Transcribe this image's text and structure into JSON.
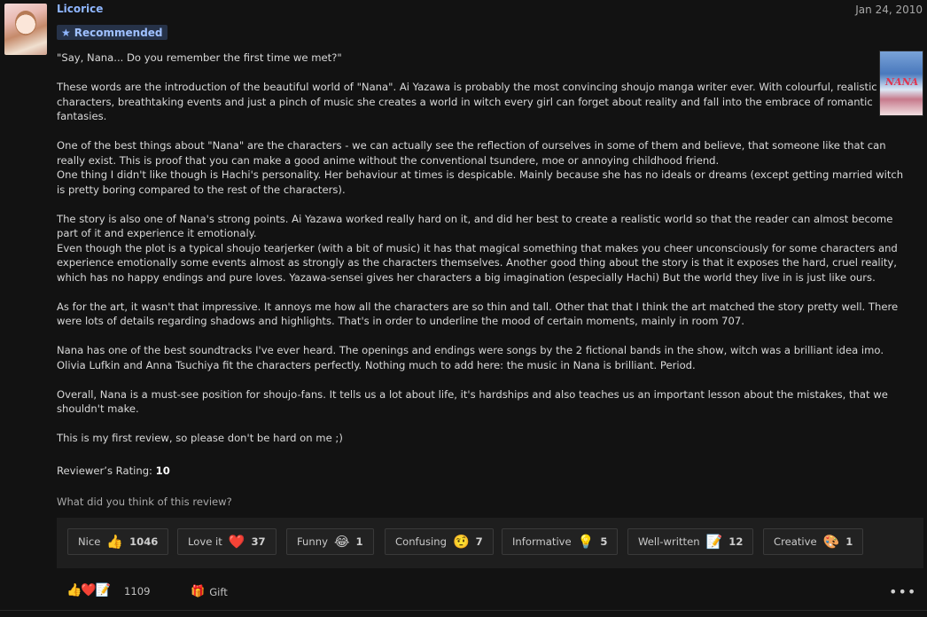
{
  "review": {
    "username": "Licorice",
    "date": "Jan 24, 2010",
    "badge": "Recommended",
    "paragraphs": [
      "\"Say, Nana... Do you remember the first time we met?\"",
      "These words are the introduction of the beautiful world of \"Nana\". Ai Yazawa is probably the most convincing shoujo manga writer ever. With colourful, realistic characters, breathtaking events and just a pinch of music she creates a world in witch every girl can forget about reality and fall into the embrace of romantic fantasies.",
      "One of the best things about \"Nana\" are the characters - we can actually see the reflection of ourselves in some of them and believe, that someone like that can really exist. This is proof that you can make a good anime without the conventional tsundere, moe or annoying childhood friend.\nOne thing I didn't like though is Hachi's personality. Her behaviour at times is despicable. Mainly because she has no ideals or dreams (except getting married witch is pretty boring compared to the rest of the characters).",
      "The story is also one of Nana's strong points. Ai Yazawa worked really hard on it, and did her best to create a realistic world so that the reader can almost become part of it and experience it emotionaly.\nEven though the plot is a typical shoujo tearjerker (with a bit of music) it has that magical something that makes you cheer unconsciously for some characters and experience emotionally some events almost as strongly as the characters themselves. Another good thing about the story is that it exposes the hard, cruel reality, which has no happy endings and pure loves. Yazawa-sensei gives her characters a big imagination (especially Hachi) But the world they live in is just like ours.",
      "As for the art, it wasn't that impressive. It annoys me how all the characters are so thin and tall. Other that that I think the art matched the story pretty well. There were lots of details regarding shadows and highlights. That's in order to underline the mood of certain moments, mainly in room 707.",
      "Nana has one of the best soundtracks I've ever heard. The openings and endings were songs by the 2 fictional bands in the show, witch was a brilliant idea imo. Olivia Lufkin and Anna Tsuchiya fit the characters perfectly. Nothing much to add here: the music in Nana is brilliant. Period.",
      "Overall, Nana is a must-see position for shoujo-fans. It tells us a lot about life, it's hardships and also teaches us an important lesson about the mistakes, that we shouldn't make.",
      "This is my first review, so please don't be hard on me ;)"
    ],
    "rating_label": "Reviewer’s Rating:",
    "rating_value": "10",
    "question": "What did you think of this review?"
  },
  "reactions": [
    {
      "label": "Nice",
      "emoji": "👍",
      "icon": "thumbs-up-icon",
      "count": "1046"
    },
    {
      "label": "Love it",
      "emoji": "❤️",
      "icon": "heart-icon",
      "count": "37"
    },
    {
      "label": "Funny",
      "emoji": "😂",
      "icon": "laughing-face-icon",
      "count": "1"
    },
    {
      "label": "Confusing",
      "emoji": "🤨",
      "icon": "confused-face-icon",
      "count": "7"
    },
    {
      "label": "Informative",
      "emoji": "💡",
      "icon": "lightbulb-icon",
      "count": "5"
    },
    {
      "label": "Well-written",
      "emoji": "📝",
      "icon": "memo-icon",
      "count": "12"
    },
    {
      "label": "Creative",
      "emoji": "🎨",
      "icon": "palette-icon",
      "count": "1"
    }
  ],
  "footer": {
    "summary_emojis": "👍❤️📝",
    "total": "1109",
    "gift_label": "Gift",
    "more_glyph": "•••"
  },
  "colors": {
    "background": "#121212",
    "username": "#8fb6ff",
    "badge_bg": "#263248",
    "reaction_bar": "#1e1e1e"
  }
}
